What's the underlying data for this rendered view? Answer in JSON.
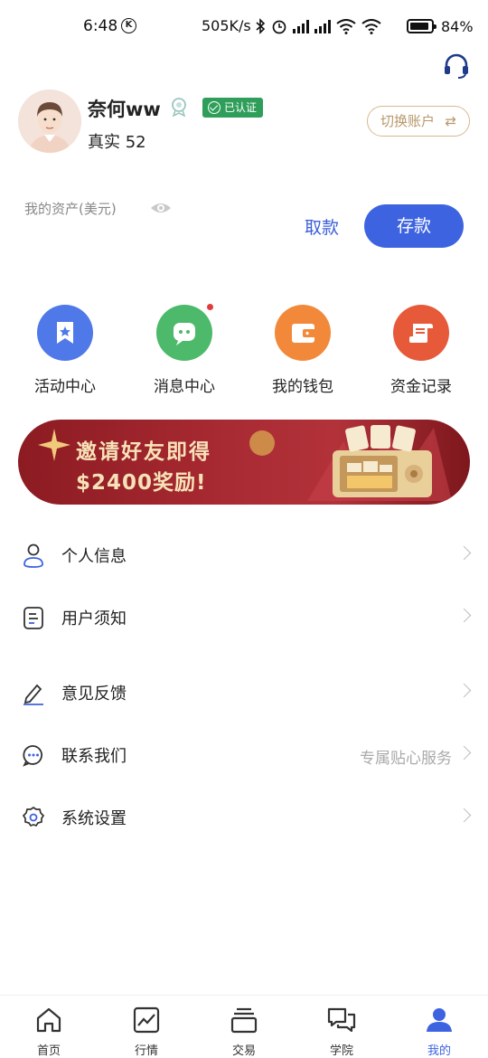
{
  "status_bar": {
    "time": "6:48",
    "k_badge": "K",
    "speed": "505K/s",
    "battery": "84%"
  },
  "header": {
    "support_icon": "headset-icon"
  },
  "profile": {
    "name": "奈何ww",
    "verified_label": "已认证",
    "account_type": "真实 52",
    "switch_label": "切换账户",
    "switch_arrows": "⇄"
  },
  "assets": {
    "label": "我的资产(美元)",
    "withdraw_label": "取款",
    "deposit_label": "存款"
  },
  "quick_actions": [
    {
      "label": "活动中心",
      "icon": "star-bookmark-icon",
      "color": "#4f78e8"
    },
    {
      "label": "消息中心",
      "icon": "chat-bubble-icon",
      "color": "#4cba6a",
      "has_dot": true
    },
    {
      "label": "我的钱包",
      "icon": "wallet-icon",
      "color": "#f2893a"
    },
    {
      "label": "资金记录",
      "icon": "ledger-icon",
      "color": "#e65a3a"
    }
  ],
  "banner": {
    "line1": "邀请好友即得",
    "line2": "$2400奖励!"
  },
  "menu": [
    {
      "label": "个人信息",
      "icon": "person-icon"
    },
    {
      "label": "用户须知",
      "icon": "notice-doc-icon"
    },
    {
      "label": "意见反馈",
      "icon": "pencil-icon"
    },
    {
      "label": "联系我们",
      "icon": "chat-dots-icon",
      "extra": "专属贴心服务"
    },
    {
      "label": "系统设置",
      "icon": "gear-icon"
    }
  ],
  "tabs": [
    {
      "label": "首页",
      "icon": "home-icon"
    },
    {
      "label": "行情",
      "icon": "chart-icon"
    },
    {
      "label": "交易",
      "icon": "layers-icon"
    },
    {
      "label": "学院",
      "icon": "chat-icon"
    },
    {
      "label": "我的",
      "icon": "user-icon",
      "active": true
    }
  ],
  "colors": {
    "primary": "#3d63e0",
    "gold": "#b8976a",
    "verified": "#2f9e5a",
    "banner": "#a52830"
  }
}
